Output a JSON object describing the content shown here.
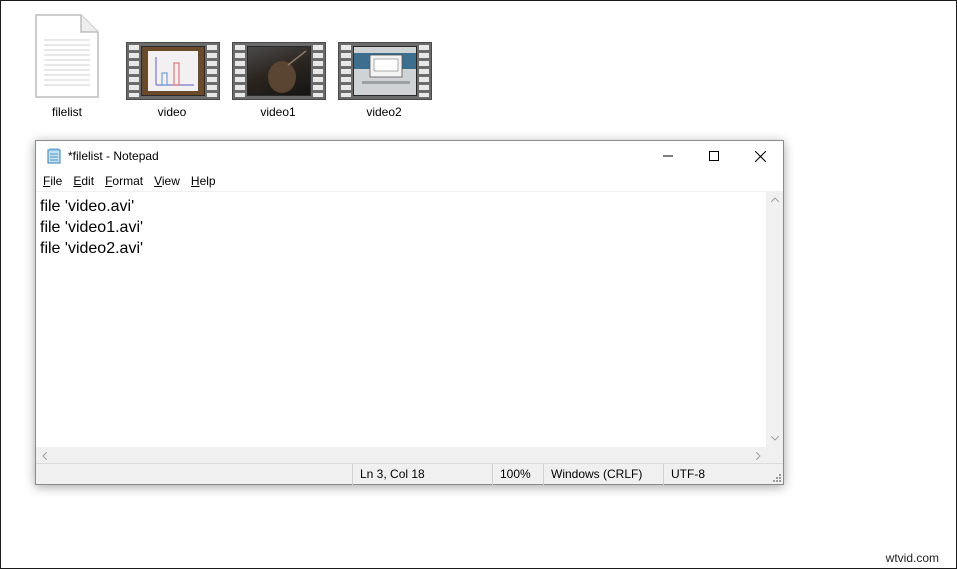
{
  "desktop": {
    "icons": [
      {
        "label": "filelist",
        "type": "document-icon"
      },
      {
        "label": "video",
        "type": "video-file-icon"
      },
      {
        "label": "video1",
        "type": "video-file-icon"
      },
      {
        "label": "video2",
        "type": "video-file-icon"
      }
    ]
  },
  "window": {
    "title": "*filelist - Notepad",
    "controls": {
      "minimize": "minimize-icon",
      "maximize": "maximize-icon",
      "close": "close-icon"
    },
    "menu": [
      {
        "label": "File",
        "accel": "F",
        "rest": "ile"
      },
      {
        "label": "Edit",
        "accel": "E",
        "rest": "dit"
      },
      {
        "label": "Format",
        "accel": "F",
        "rest": "ormat",
        "pre": ""
      },
      {
        "label": "View",
        "accel": "V",
        "rest": "iew"
      },
      {
        "label": "Help",
        "accel": "H",
        "rest": "elp"
      }
    ],
    "content_lines": [
      "file 'video.avi'",
      "file 'video1.avi'",
      "file 'video2.avi'"
    ],
    "status": {
      "position": "Ln 3, Col 18",
      "zoom": "100%",
      "line_endings": "Windows (CRLF)",
      "encoding": "UTF-8"
    }
  },
  "watermark": "wtvid.com",
  "colors": {
    "background": "#ffffff",
    "statusbar": "#f0f0f0",
    "film_strip": "#6b6b6b"
  }
}
